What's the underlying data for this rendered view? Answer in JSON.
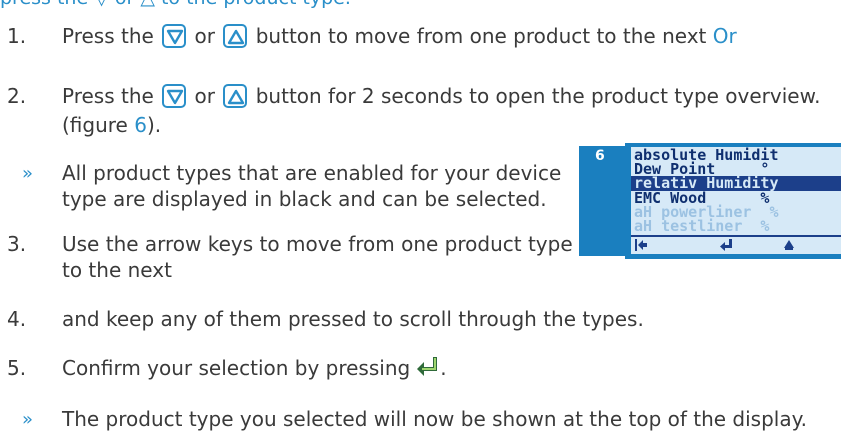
{
  "header_cut": "press the ▽ or △ to the product type.",
  "steps": [
    {
      "num": "1.",
      "pre": "Press the",
      "mid": "or",
      "post": "button to move from one product to the next",
      "tail": "Or"
    },
    {
      "num": "2.",
      "pre": "Press the",
      "mid": "or",
      "post": "button for 2 seconds to open the product type overview.",
      "cont_pre": "(figure ",
      "cont_link": "6",
      "cont_post": ")."
    },
    {
      "num": "3.",
      "line1": "Use the arrow keys to move from one product type",
      "line2": "to the next"
    },
    {
      "num": "4.",
      "line1": "and keep any of them pressed to scroll through the types."
    },
    {
      "num": "5.",
      "line1": "Confirm your selection by pressing",
      "suffix": "."
    }
  ],
  "results": [
    {
      "marker": "»",
      "line1": "All product types that are enabled for your device",
      "line2": "type are displayed in black and can be selected."
    },
    {
      "marker": "»",
      "line1": "The product type you selected will now be shown at the top of the display."
    }
  ],
  "figure": {
    "number": "6",
    "lcd_rows": [
      {
        "text": "absolute Humidit",
        "state": "normal"
      },
      {
        "text": "Dew Point     °",
        "state": "normal"
      },
      {
        "text": "relativ Humidity",
        "state": "selected"
      },
      {
        "text": "EMC Wood      %",
        "state": "normal"
      },
      {
        "text": "aH powerliner  %",
        "state": "dim"
      },
      {
        "text": "aH testliner  %",
        "state": "dim"
      }
    ],
    "footer_icons": [
      "back-icon",
      "enter-icon",
      "up-arrow-icon"
    ]
  },
  "colors": {
    "accent": "#2a8fc9",
    "lcd_frame": "#1a7fbf",
    "lcd_background": "#d6e9f7",
    "lcd_text": "#0f2f6f"
  }
}
